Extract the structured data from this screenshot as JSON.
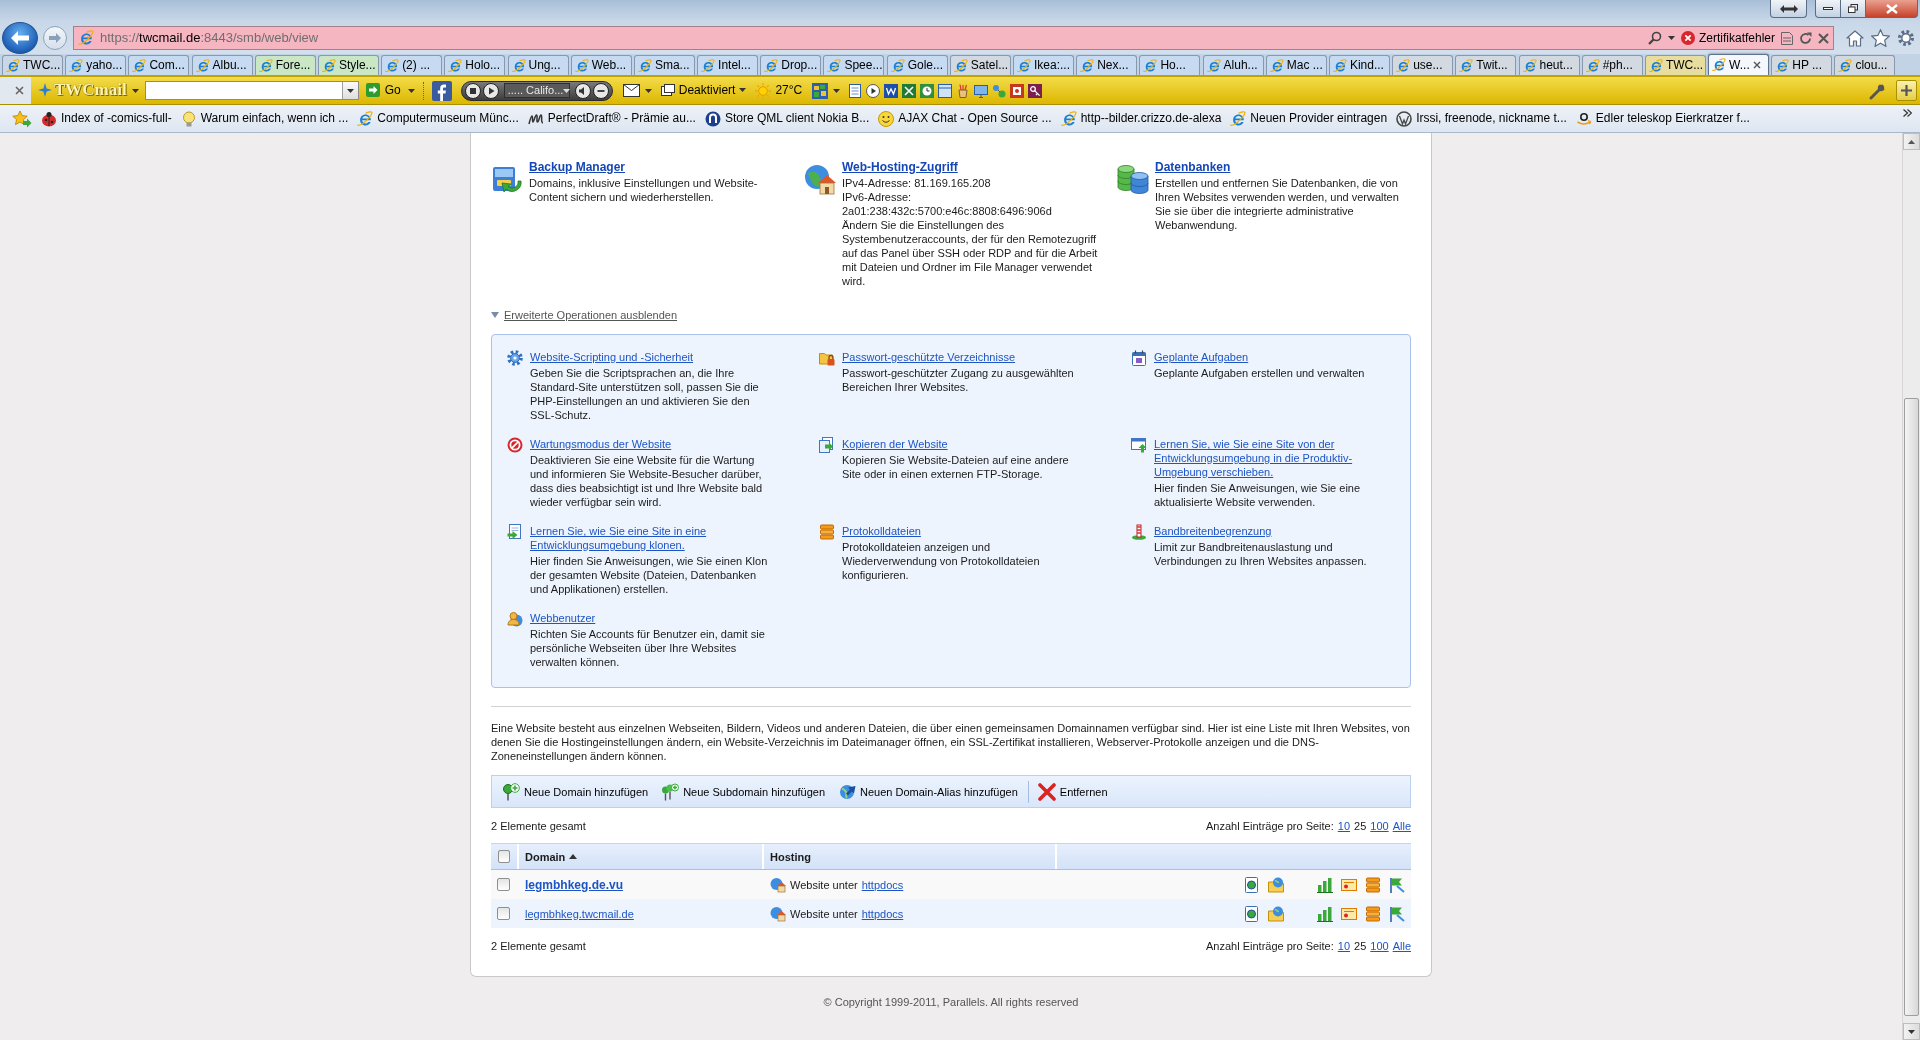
{
  "address_bar": {
    "url": {
      "scheme": "https://",
      "host": "twcmail.de",
      "path": ":8443/smb/web/view"
    },
    "certificate_error": "Zertifikatfehler"
  },
  "tabs": [
    {
      "label": "TWC...",
      "selected": false,
      "color": "#cad7e7"
    },
    {
      "label": "yaho...",
      "selected": false,
      "color": "#c6daf1"
    },
    {
      "label": "Com...",
      "selected": false,
      "color": "#c6daf1"
    },
    {
      "label": "Albu...",
      "selected": false,
      "color": "#c6daf1"
    },
    {
      "label": "Fore...",
      "selected": false,
      "color": "#c9e6c5"
    },
    {
      "label": "Style...",
      "selected": false,
      "color": "#c9e6c5"
    },
    {
      "label": "(2) ...",
      "selected": false,
      "color": "#c6daf1"
    },
    {
      "label": "Holo...",
      "selected": false,
      "color": "#c6daf1"
    },
    {
      "label": "Ung...",
      "selected": false,
      "color": "#c6daf1"
    },
    {
      "label": "Web...",
      "selected": false,
      "color": "#c6daf1"
    },
    {
      "label": "Sma...",
      "selected": false,
      "color": "#c6daf1"
    },
    {
      "label": "Intel...",
      "selected": false,
      "color": "#c6daf1"
    },
    {
      "label": "Drop...",
      "selected": false,
      "color": "#c6daf1"
    },
    {
      "label": "Spee...",
      "selected": false,
      "color": "#c6daf1"
    },
    {
      "label": "Gole...",
      "selected": false,
      "color": "#c6daf1"
    },
    {
      "label": "Satel...",
      "selected": false,
      "color": "#d3d9e1"
    },
    {
      "label": "Ikea:...",
      "selected": false,
      "color": "#c6daf1"
    },
    {
      "label": "Nex...",
      "selected": false,
      "color": "#c6daf1"
    },
    {
      "label": "Ho...",
      "selected": false,
      "color": "#c6daf1"
    },
    {
      "label": "Aluh...",
      "selected": false,
      "color": "#c6daf1"
    },
    {
      "label": "Mac ...",
      "selected": false,
      "color": "#c6daf1"
    },
    {
      "label": "Kind...",
      "selected": false,
      "color": "#c6daf1"
    },
    {
      "label": "use...",
      "selected": false,
      "color": "#d3d9e1"
    },
    {
      "label": "Twit...",
      "selected": false,
      "color": "#d3d9e1"
    },
    {
      "label": "heut...",
      "selected": false,
      "color": "#d3d9e1"
    },
    {
      "label": "#ph...",
      "selected": false,
      "color": "#d3d9e1"
    },
    {
      "label": "TWC...",
      "selected": false,
      "color": "#e6dd9f"
    },
    {
      "label": "W...",
      "selected": true,
      "color": "#f4f7fb"
    },
    {
      "label": "HP ...",
      "selected": false,
      "color": "#d3d9e1"
    },
    {
      "label": "clou...",
      "selected": false,
      "color": "#d3d9e1"
    }
  ],
  "command_bar": {
    "toolbar_name": "TWCmail",
    "go_label": "Go",
    "media_title": "..... Califo...",
    "popup_blocker": "Deaktiviert",
    "temperature": "27°C"
  },
  "favorites": [
    {
      "label": "Index of -comics-full-"
    },
    {
      "label": "Warum einfach, wenn ich ..."
    },
    {
      "label": "Computermuseum Münc..."
    },
    {
      "label": "PerfectDraft® - Prämie au..."
    },
    {
      "label": "Store QML client Nokia B..."
    },
    {
      "label": "AJAX Chat - Open Source ..."
    },
    {
      "label": "http--bilder.crizzo.de-alexa"
    },
    {
      "label": "Neuen Provider eintragen"
    },
    {
      "label": "Irssi, freenode, nickname t..."
    },
    {
      "label": "Edler teleskop Eierkratzer f..."
    }
  ],
  "top_tools": [
    {
      "title": "Backup Manager",
      "lines": [
        "Domains, inklusive Einstellungen und Website-Content sichern und wiederherstellen."
      ]
    },
    {
      "title": "Web-Hosting-Zugriff",
      "lines": [
        "IPv4-Adresse: 81.169.165.208",
        "IPv6-Adresse: 2a01:238:432c:5700:e46c:8808:6496:906d",
        "Ändern Sie die Einstellungen des Systembenutzeraccounts, der für den Remotezugriff auf das Panel über SSH oder RDP and für die Arbeit mit Dateien und Ordner im File Manager verwendet wird."
      ]
    },
    {
      "title": "Datenbanken",
      "lines": [
        "Erstellen und entfernen Sie Datenbanken, die von Ihren Websites verwenden werden, und verwalten Sie sie über die integrierte administrative Webanwendung."
      ]
    }
  ],
  "advanced_toggle": {
    "label": "Erweiterte Operationen ausblenden",
    "expanded": true
  },
  "advanced_tools": [
    {
      "title": "Website-Scripting und -Sicherheit",
      "description": "Geben Sie die Scriptsprachen an, die Ihre Standard-Site unterstützen soll, passen Sie die PHP-Einstellungen an und aktivieren Sie den SSL-Schutz."
    },
    {
      "title": "Passwort-geschützte Verzeichnisse",
      "description": "Passwort-geschützter Zugang zu ausgewählten Bereichen Ihrer Websites."
    },
    {
      "title": "Geplante Aufgaben",
      "description": "Geplante Aufgaben erstellen und verwalten"
    },
    {
      "title": "Wartungsmodus der Website",
      "description": "Deaktivieren Sie eine Website für die Wartung und informieren Sie Website-Besucher darüber, dass dies beabsichtigt ist und Ihre Website bald wieder verfügbar sein wird."
    },
    {
      "title": "Kopieren der Website",
      "description": "Kopieren Sie Website-Dateien auf eine andere Site oder in einen externen FTP-Storage."
    },
    {
      "title": "Lernen Sie, wie Sie eine Site von der Entwicklungsumgebung in die Produktiv-Umgebung verschieben.",
      "description": "Hier finden Sie Anweisungen, wie Sie eine aktualisierte Website verwenden."
    },
    {
      "title": "Lernen Sie, wie Sie eine Site in eine Entwicklungsumgebung klonen.",
      "description": "Hier finden Sie Anweisungen, wie Sie einen Klon der gesamten Website (Dateien, Datenbanken und Applikationen) erstellen."
    },
    {
      "title": "Protokolldateien",
      "description": "Protokolldateien anzeigen und Wiederverwendung von Protokolldateien konfigurieren."
    },
    {
      "title": "Bandbreitenbegrenzung",
      "description": "Limit zur Bandbreitenauslastung und Verbindungen zu Ihren Websites anpassen."
    },
    {
      "title": "Webbenutzer",
      "description": "Richten Sie Accounts für Benutzer ein, damit sie persönliche Webseiten über Ihre Websites verwalten können."
    }
  ],
  "intro_text": "Eine Website besteht aus einzelnen Webseiten, Bildern, Videos und anderen Dateien, die über einen gemeinsamen Domainnamen verfügbar sind. Hier ist eine Liste mit Ihren Websites, von denen Sie die Hostingeinstellungen ändern, ein Website-Verzeichnis im Dateimanager öffnen, ein SSL-Zertifikat installieren, Webserver-Protokolle anzeigen und die DNS-Zoneneinstellungen ändern können.",
  "toolbar": {
    "groups": [
      [
        {
          "label": "Neue Domain hinzufügen"
        },
        {
          "label": "Neue Subdomain hinzufügen"
        },
        {
          "label": "Neuen Domain-Alias hinzufügen"
        }
      ],
      [
        {
          "label": "Entfernen"
        }
      ]
    ]
  },
  "pager_top": {
    "total": "2 Elemente gesamt",
    "per_page_label": "Anzahl Einträge pro Seite:",
    "sizes": [
      {
        "label": "10",
        "selected": false
      },
      {
        "label": "25",
        "selected": true
      },
      {
        "label": "100",
        "selected": false
      },
      {
        "label": "Alle",
        "selected": false
      }
    ]
  },
  "table": {
    "select_all": {
      "checked": false
    },
    "columns": [
      {
        "label": "Domain",
        "sorted": true
      },
      {
        "label": "Hosting",
        "sorted": false
      }
    ],
    "rows": [
      {
        "checked": false,
        "kind": "main",
        "domain": "legmbhkeg.de.vu",
        "hosting": "Website unter",
        "hosting_link": "httpdocs"
      },
      {
        "checked": false,
        "kind": "sub",
        "domain": "legmbhkeg.twcmail.de",
        "hosting": "Website unter",
        "hosting_link": "httpdocs"
      }
    ]
  },
  "pager_bottom": {
    "total": "2 Elemente gesamt",
    "per_page_label": "Anzahl Einträge pro Seite:",
    "sizes": [
      {
        "label": "10",
        "selected": false
      },
      {
        "label": "25",
        "selected": true
      },
      {
        "label": "100",
        "selected": false
      },
      {
        "label": "Alle",
        "selected": false
      }
    ]
  },
  "footer": {
    "copyright": "© Copyright 1999-2011, Parallels. All rights reserved"
  }
}
